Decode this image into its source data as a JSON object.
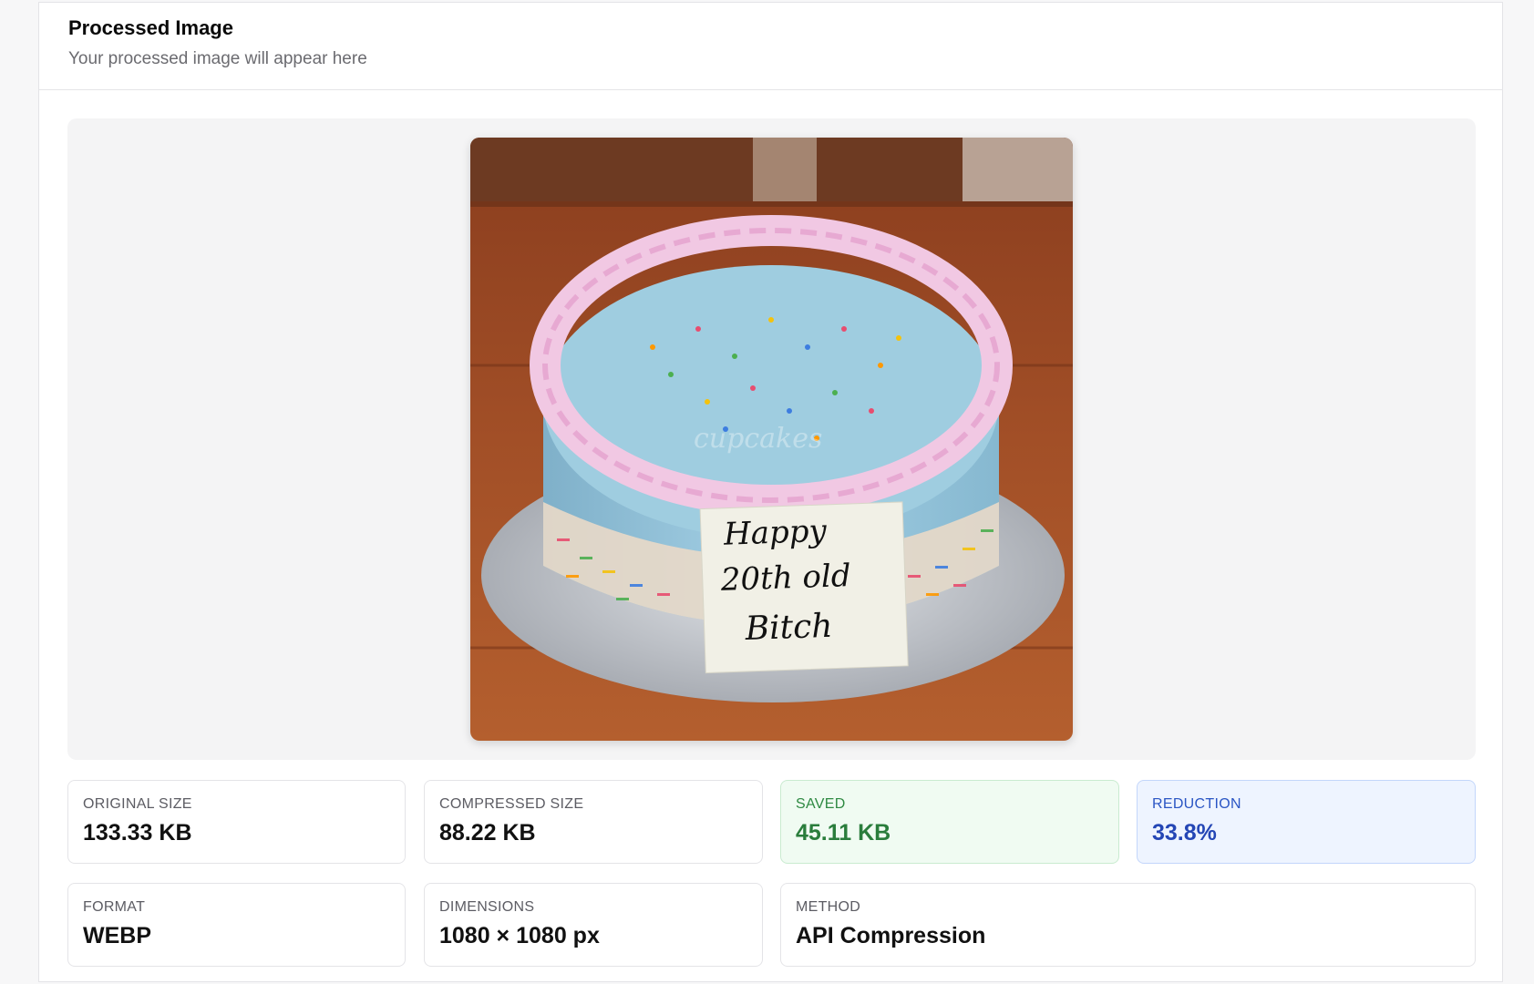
{
  "header": {
    "title": "Processed Image",
    "subtitle": "Your processed image will appear here"
  },
  "preview": {
    "watermark": "cupcakes",
    "plaque_text": [
      "Happy",
      "20th old",
      "Bitch"
    ]
  },
  "stats": {
    "original_size": {
      "label": "ORIGINAL SIZE",
      "value": "133.33 KB"
    },
    "compressed_size": {
      "label": "COMPRESSED SIZE",
      "value": "88.22 KB"
    },
    "saved": {
      "label": "SAVED",
      "value": "45.11 KB"
    },
    "reduction": {
      "label": "REDUCTION",
      "value": "33.8%"
    },
    "format": {
      "label": "FORMAT",
      "value": "WEBP"
    },
    "dimensions": {
      "label": "DIMENSIONS",
      "value": "1080 × 1080 px"
    },
    "method": {
      "label": "METHOD",
      "value": "API Compression"
    }
  },
  "colors": {
    "saved_accent": "#2a7d3c",
    "reduction_accent": "#2446b5"
  }
}
